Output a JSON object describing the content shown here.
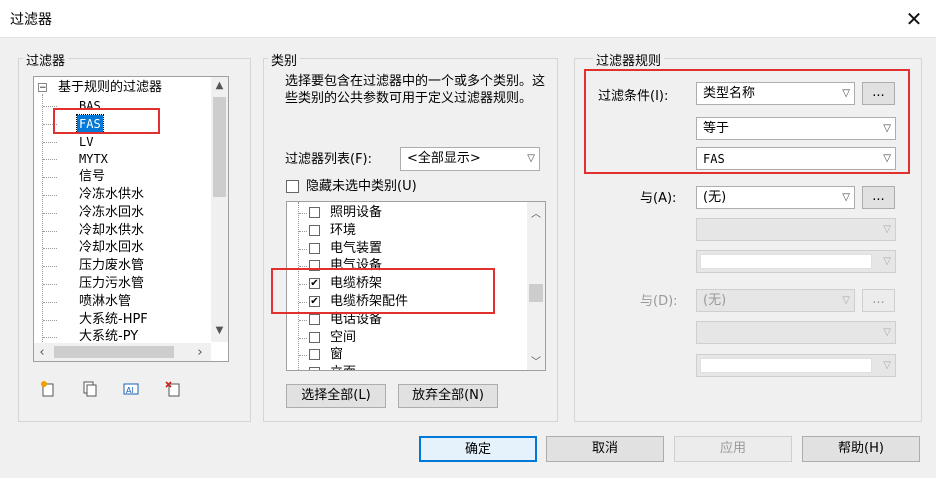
{
  "window": {
    "title": "过滤器",
    "close_glyph": "✕"
  },
  "filters_panel": {
    "label": "过滤器",
    "tree_root": "基于规则的过滤器",
    "items": [
      "BAS",
      "FAS",
      "LV",
      "MYTX",
      "信号",
      "冷冻水供水",
      "冷冻水回水",
      "冷却水供水",
      "冷却水回水",
      "压力废水管",
      "压力污水管",
      "喷淋水管",
      "大系统-HPF",
      "大系统-PY"
    ],
    "selected": "FAS",
    "toolbar_icons": [
      "new-filter-icon",
      "duplicate-filter-icon",
      "rename-filter-icon",
      "delete-filter-icon"
    ]
  },
  "category_panel": {
    "label": "类别",
    "description": "选择要包含在过滤器中的一个或多个类别。这些类别的公共参数可用于定义过滤器规则。",
    "filter_list_label": "过滤器列表(F):",
    "filter_list_value": "<全部显示>",
    "hide_unchecked_label": "隐藏未选中类别(U)",
    "items": [
      {
        "label": "照明设备",
        "checked": false
      },
      {
        "label": "环境",
        "checked": false
      },
      {
        "label": "电气装置",
        "checked": false
      },
      {
        "label": "电气设备",
        "checked": false
      },
      {
        "label": "电缆桥架",
        "checked": true
      },
      {
        "label": "电缆桥架配件",
        "checked": true
      },
      {
        "label": "电话设备",
        "checked": false
      },
      {
        "label": "空间",
        "checked": false
      },
      {
        "label": "窗",
        "checked": false
      },
      {
        "label": "立面",
        "checked": false
      }
    ],
    "select_all": "选择全部(L)",
    "deselect_all": "放弃全部(N)"
  },
  "rules_panel": {
    "label": "过滤器规则",
    "condition_label": "过滤条件(I):",
    "param_value": "类型名称",
    "operator_value": "等于",
    "value_value": "FAS",
    "and_a_label": "与(A):",
    "and_a_value": "(无)",
    "and_d_label": "与(D):",
    "and_d_value": "(无)",
    "ellipsis": "..."
  },
  "footer": {
    "ok": "确定",
    "cancel": "取消",
    "apply": "应用",
    "help": "帮助(H)"
  },
  "colors": {
    "highlight": "#0078d7",
    "annotation": "#e03030"
  }
}
